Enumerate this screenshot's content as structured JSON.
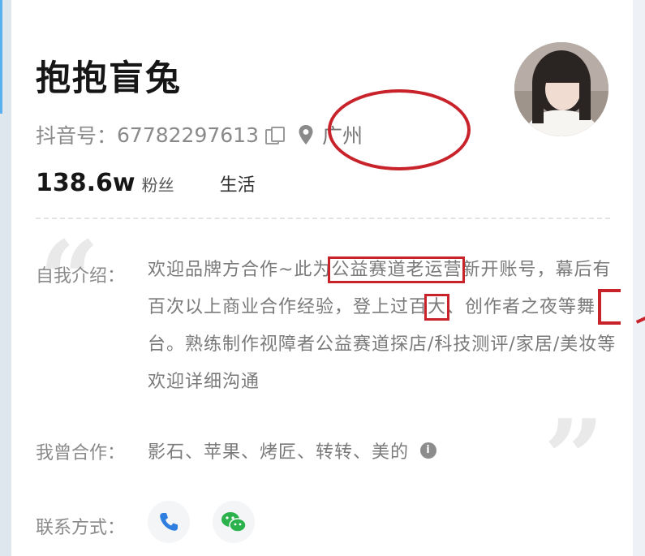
{
  "profile": {
    "name": "抱抱盲兔",
    "id_label": "抖音号：",
    "id_value": "67782297613",
    "location": "广州",
    "fans_count": "138.6w",
    "fans_label": "粉丝",
    "category": "生活"
  },
  "intro": {
    "label": "自我介绍：",
    "seg1": "欢迎品牌方合作~此为",
    "seg2": "公益赛道老运营",
    "seg3": "新开账号，幕后有百次以上商业合作经验，登上过",
    "seg4": "百",
    "seg5": "大",
    "seg6": "、创作者之夜等舞台。熟练制作视障者公益赛道探店/科技测评/家居/美妆等 欢迎详细沟通"
  },
  "cooperation": {
    "label": "我曾合作：",
    "brands": "影石、苹果、烤匠、转转、美的"
  },
  "contact": {
    "label": "联系方式："
  },
  "icons": {
    "copy": "copy-icon",
    "location": "location-pin-icon",
    "info": "info-icon",
    "phone": "phone-icon",
    "wechat": "wechat-icon"
  },
  "colors": {
    "annotation_red": "#c8232b",
    "phone_blue": "#2f7fe0",
    "wechat_green": "#2bb24c"
  }
}
